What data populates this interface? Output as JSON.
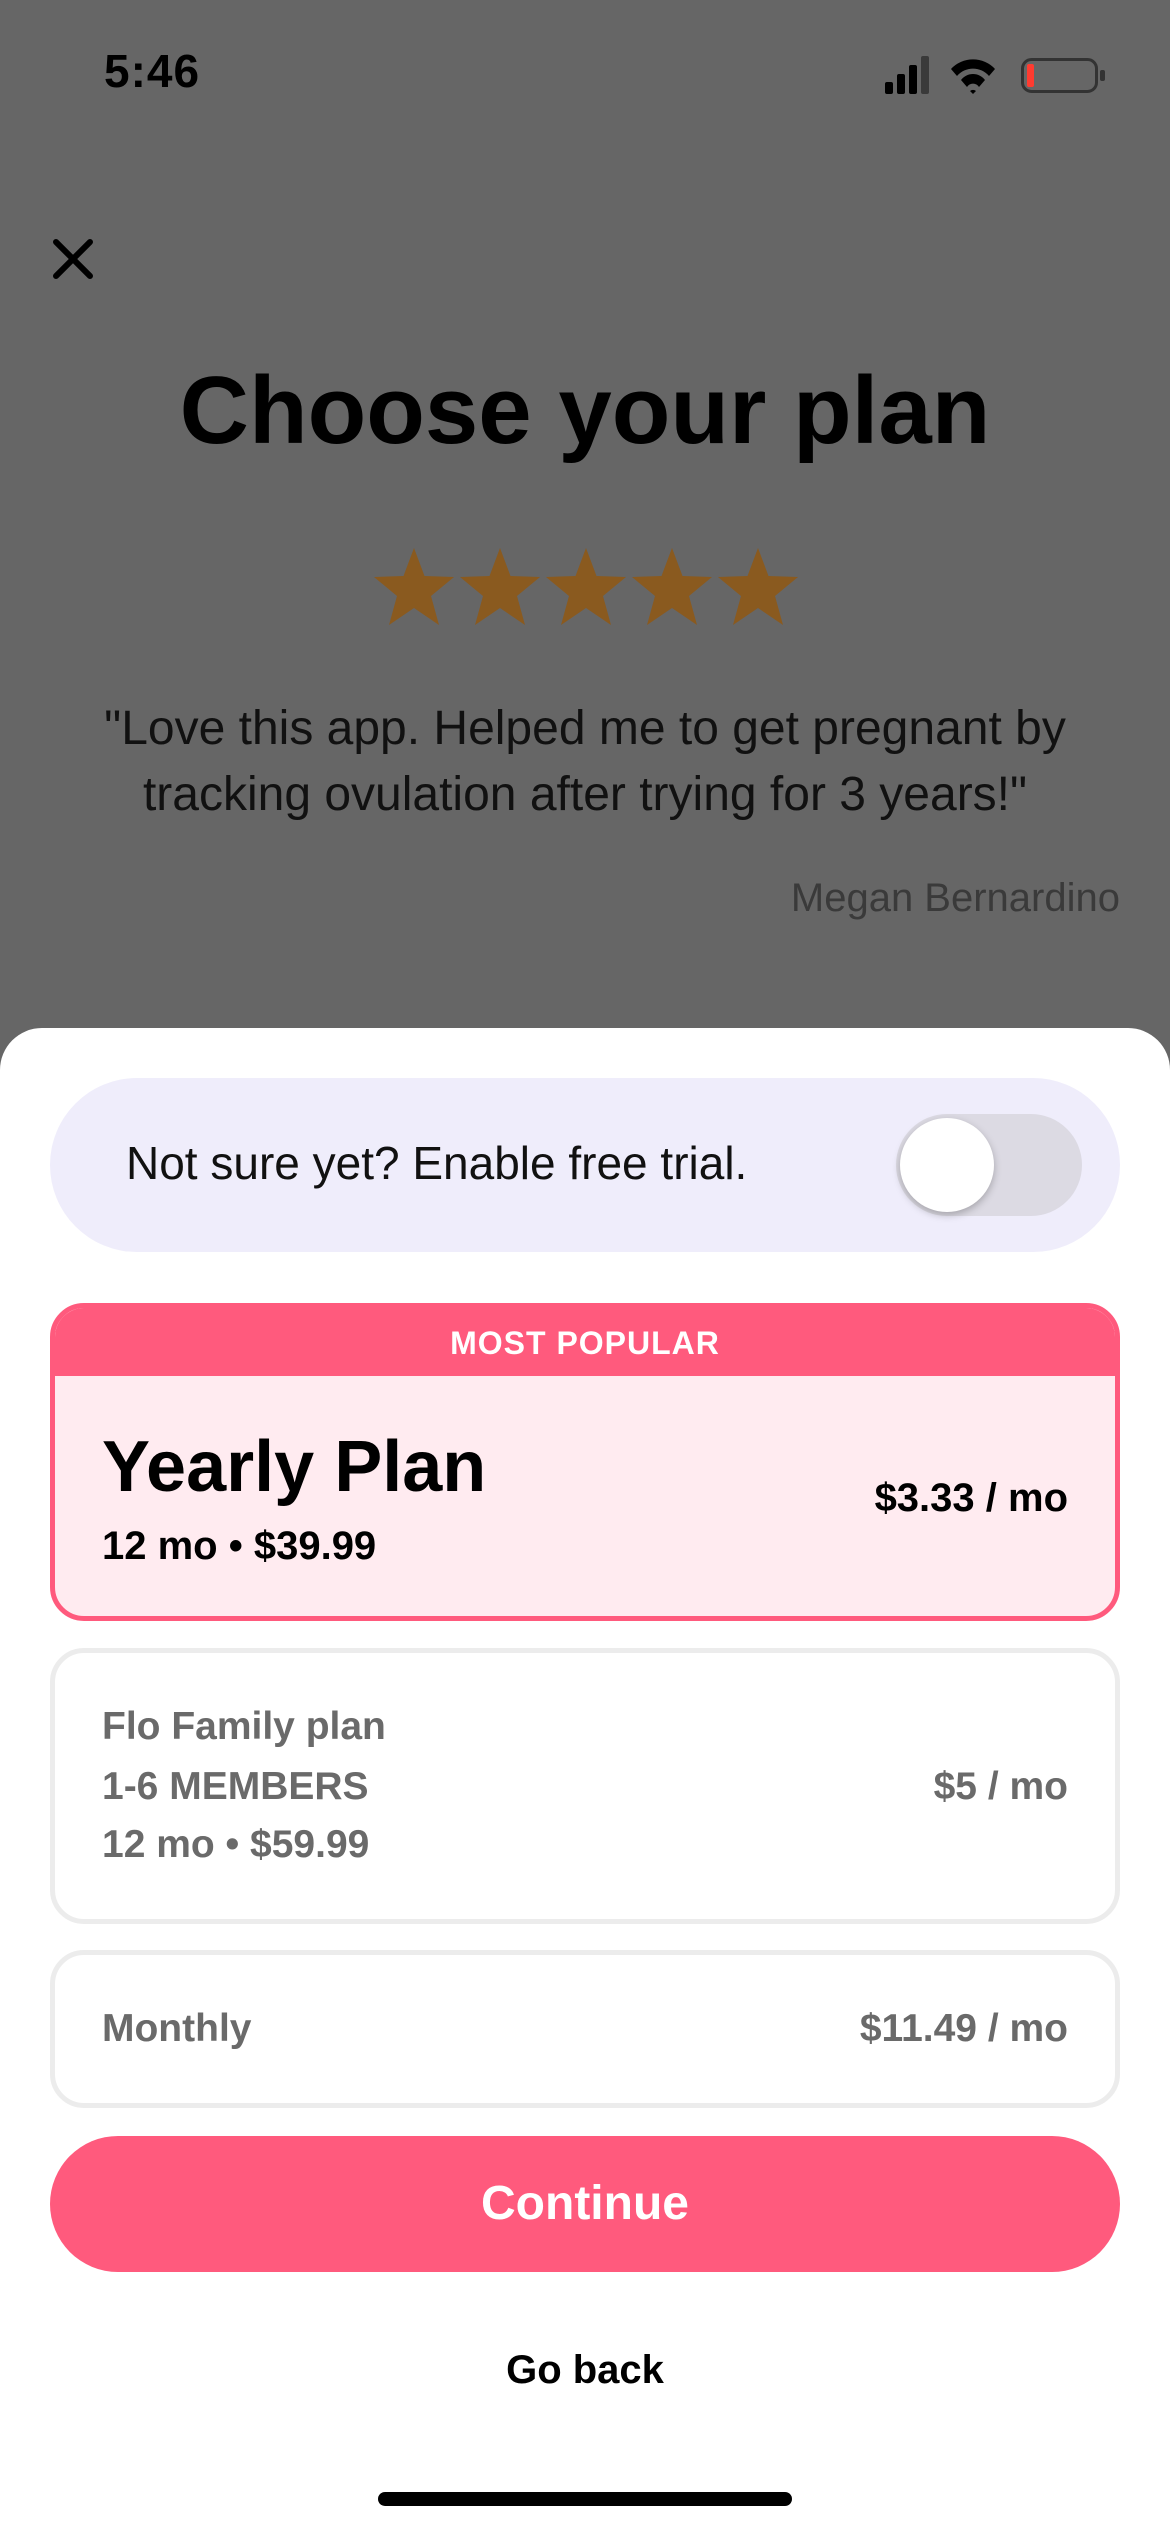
{
  "status_bar": {
    "time": "5:46",
    "icons": [
      "cellular-signal-icon",
      "wifi-icon",
      "battery-icon"
    ]
  },
  "header": {
    "close_icon": "close-icon",
    "title": "Choose your plan",
    "rating_stars": 5,
    "star_color": "#8a5a1f",
    "quote": "\"Love this app. Helped me to get pregnant by tracking ovulation after trying for 3 years!\"",
    "author": "Megan Bernardino"
  },
  "trial": {
    "label": "Not sure yet? Enable free trial.",
    "enabled": false
  },
  "plans": {
    "yearly": {
      "badge": "MOST POPULAR",
      "name": "Yearly Plan",
      "subtitle": "12 mo • $39.99",
      "price": "$3.33 / mo",
      "selected": true
    },
    "family": {
      "name": "Flo Family plan",
      "members": "1-6 MEMBERS",
      "subtitle": "12 mo • $59.99",
      "price": "$5 / mo"
    },
    "monthly": {
      "name": "Monthly",
      "price": "$11.49 / mo"
    }
  },
  "actions": {
    "continue_label": "Continue",
    "go_back_label": "Go back"
  },
  "colors": {
    "accent": "#ff5a7d",
    "selected_bg": "#ffebf0",
    "trial_bg": "#efedfb",
    "overlay": "#666666"
  }
}
